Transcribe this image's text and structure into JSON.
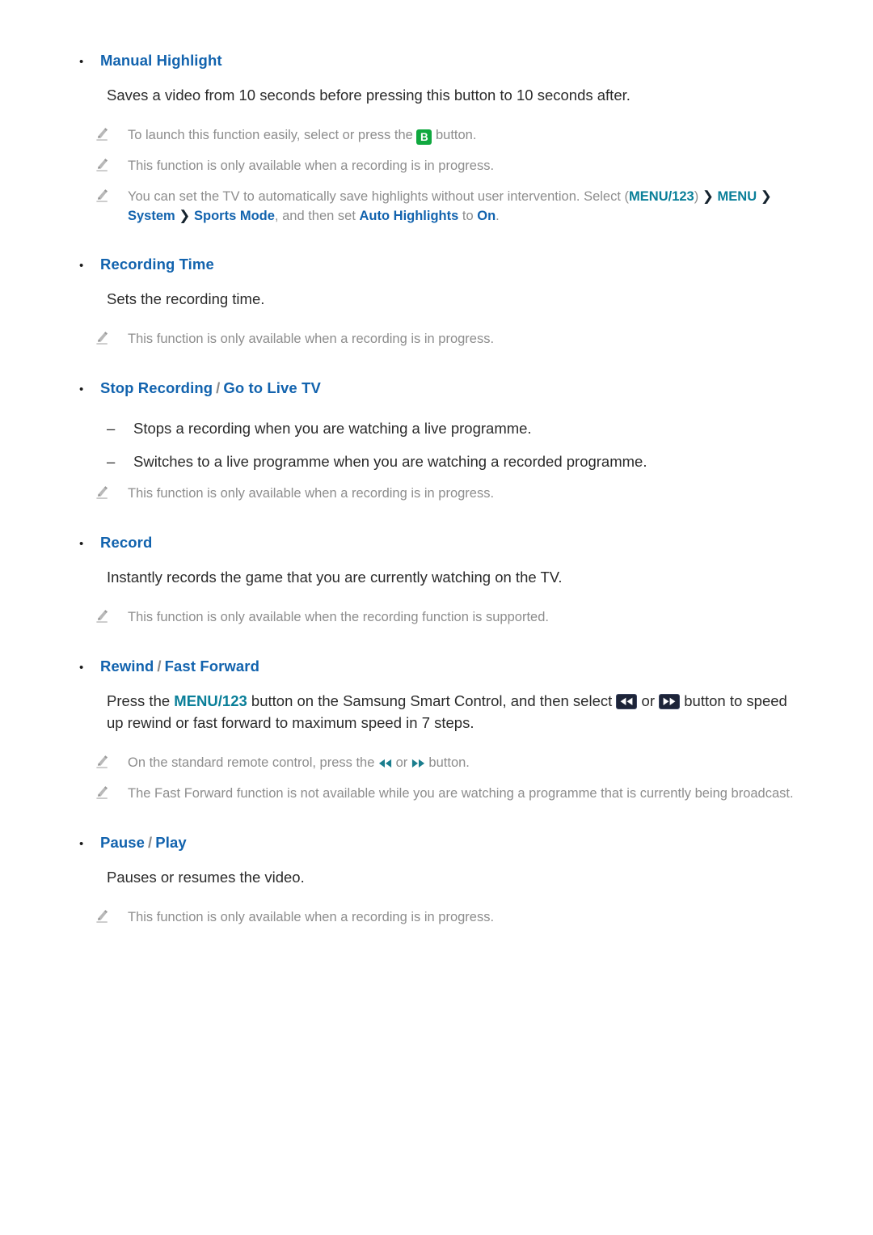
{
  "page": {
    "sections": [
      {
        "id": "manual-highlight",
        "title": "Manual Highlight",
        "body": "Saves a video from 10 seconds before pressing this button to 10 seconds after.",
        "notes": [
          {
            "id": "note-launch-b-button",
            "before": "To launch this function easily, select or press the ",
            "key": "B",
            "after": " button."
          },
          {
            "id": "note-recording-in-progress",
            "text": "This function is only available when a recording is in progress."
          },
          {
            "id": "note-auto-highlights-path",
            "lead": "You can set the TV to automatically save highlights without user intervention. Select ",
            "path_open": "(",
            "path": [
              {
                "label": "MENU/123",
                "style": "teal"
              },
              {
                "label": "MENU",
                "style": "teal"
              },
              {
                "label": "System",
                "style": "blue"
              },
              {
                "label": "Sports Mode",
                "style": "blue"
              }
            ],
            "path_close": ")",
            "chevron": "❯",
            "mid": ", and then set ",
            "setting": "Auto Highlights",
            "joiner": " to ",
            "value": "On",
            "end": "."
          }
        ]
      },
      {
        "id": "recording-time",
        "title": "Recording Time",
        "body": "Sets the recording time.",
        "notes": [
          {
            "id": "note-recording-in-progress",
            "text": "This function is only available when a recording is in progress."
          }
        ]
      },
      {
        "id": "stop-recording-go-to-live-tv",
        "title_parts": [
          "Stop Recording",
          "Go to Live TV"
        ],
        "separator": "/",
        "dash_items": [
          "Stops a recording when you are watching a live programme.",
          "Switches to a live programme when you are watching a recorded programme."
        ],
        "notes": [
          {
            "id": "note-recording-in-progress",
            "text": "This function is only available when a recording is in progress."
          }
        ]
      },
      {
        "id": "record",
        "title": "Record",
        "body": "Instantly records the game that you are currently watching on the TV.",
        "notes": [
          {
            "id": "note-recording-supported",
            "text": "This function is only available when the recording function is supported."
          }
        ]
      },
      {
        "id": "rewind-fast-forward",
        "title_parts": [
          "Rewind",
          "Fast Forward"
        ],
        "separator": "/",
        "body_parts": {
          "p1": "Press the ",
          "menu_key": "MENU/123",
          "p2": " button on the Samsung Smart Control, and then select ",
          "rewind_key_icon": "rewind-key-icon",
          "or": " or ",
          "forward_key_icon": "fast-forward-key-icon",
          "p3": " button to speed up rewind or fast forward to maximum speed in 7 steps."
        },
        "notes": [
          {
            "id": "note-standard-remote",
            "before": "On the standard remote control, press the ",
            "glyph_rewind": "rewind-glyph-icon",
            "or": " or ",
            "glyph_forward": "fast-forward-glyph-icon",
            "after": " button."
          },
          {
            "id": "note-fast-forward-unavailable",
            "text": "The Fast Forward function is not available while you are watching a programme that is currently being broadcast."
          }
        ]
      },
      {
        "id": "pause-play",
        "title_parts": [
          "Pause",
          "Play"
        ],
        "separator": "/",
        "body": "Pauses or resumes the video.",
        "notes": [
          {
            "id": "note-recording-in-progress",
            "text": "This function is only available when a recording is in progress."
          }
        ]
      }
    ],
    "bullet_glyph": "•",
    "dash_glyph": "–",
    "colors": {
      "heading_blue": "#1263ae",
      "teal": "#0a7f99",
      "note_gray": "#8d8d8d",
      "body": "#2b2b2b",
      "green_key": "#10a83f",
      "dark_key": "#1d2438"
    }
  }
}
